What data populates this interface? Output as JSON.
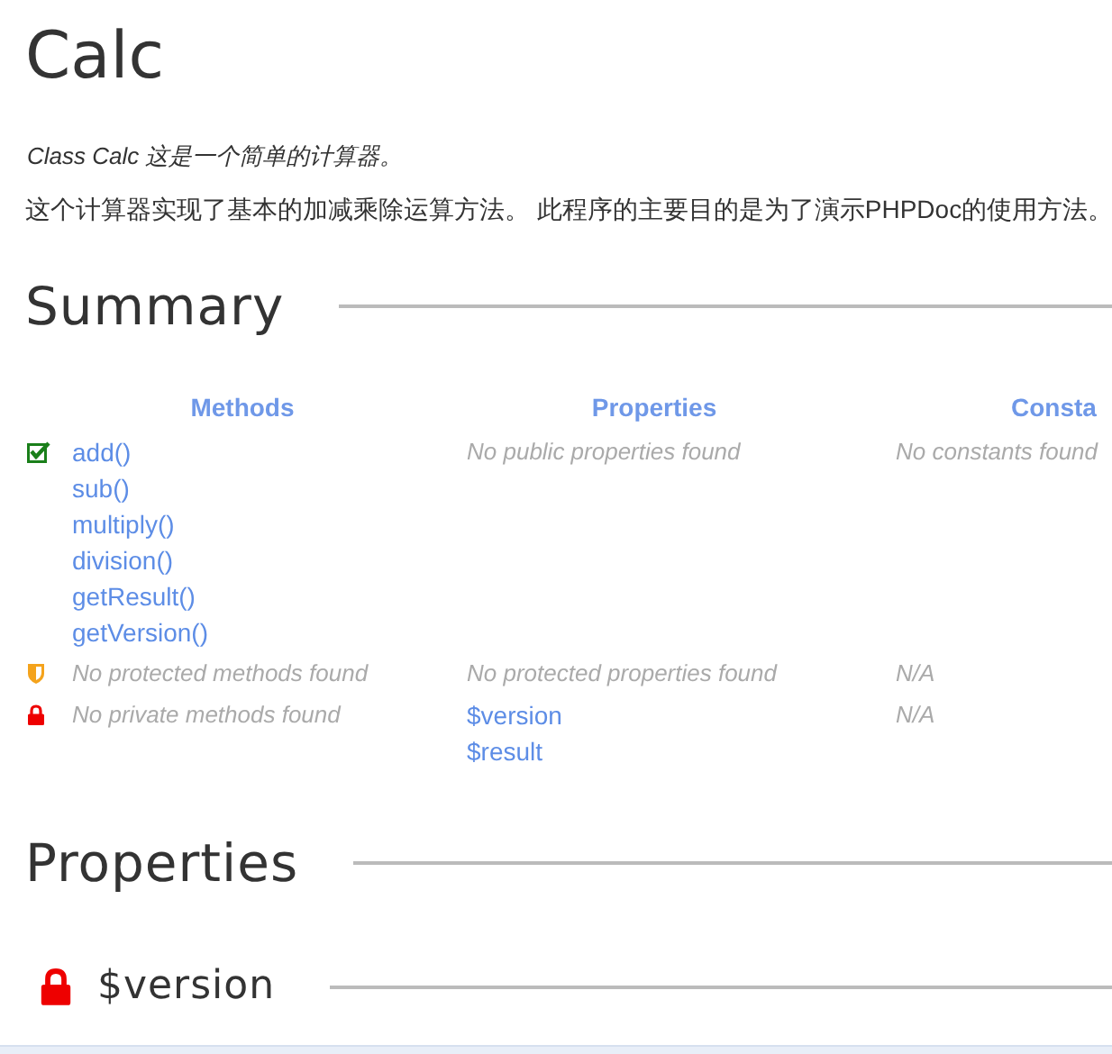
{
  "title": "Calc",
  "short_description": "Class Calc 这是一个简单的计算器。",
  "description": "这个计算器实现了基本的加减乘除运算方法。 此程序的主要目的是为了演示PHPDoc的使用方法。",
  "summary": {
    "heading": "Summary",
    "columns": [
      "Methods",
      "Properties",
      "Consta"
    ],
    "rows": [
      {
        "kind": "public",
        "methods": {
          "kind": "links",
          "items": [
            "add()",
            "sub()",
            "multiply()",
            "division()",
            "getResult()",
            "getVersion()"
          ]
        },
        "properties": {
          "kind": "empty",
          "items": [
            "No public properties found"
          ]
        },
        "constants": {
          "kind": "empty",
          "items": [
            "No constants found"
          ]
        }
      },
      {
        "kind": "protected",
        "methods": {
          "kind": "empty",
          "items": [
            "No protected methods found"
          ]
        },
        "properties": {
          "kind": "empty",
          "items": [
            "No protected properties found"
          ]
        },
        "constants": {
          "kind": "empty",
          "items": [
            "N/A"
          ]
        }
      },
      {
        "kind": "private",
        "methods": {
          "kind": "empty",
          "items": [
            "No private methods found"
          ]
        },
        "properties": {
          "kind": "links",
          "items": [
            "$version",
            "$result"
          ]
        },
        "constants": {
          "kind": "empty",
          "items": [
            "N/A"
          ]
        }
      }
    ]
  },
  "properties_section": {
    "heading": "Properties",
    "items": [
      {
        "name": "$version",
        "kind": "private"
      }
    ]
  }
}
